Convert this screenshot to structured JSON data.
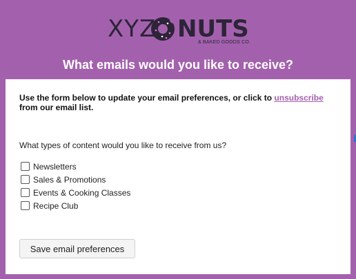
{
  "logo": {
    "part1": "XYZ",
    "part2": "NUTS",
    "tagline": "& BAKED GOODS CO."
  },
  "heading": "What emails would you like to receive?",
  "intro": {
    "before": "Use the form below to update your email preferences, or click to ",
    "link": "unsubscribe",
    "after": " from our email list."
  },
  "question": "What types of content would you like to receive from us?",
  "options": [
    {
      "label": "Newsletters",
      "checked": false
    },
    {
      "label": "Sales & Promotions",
      "checked": false
    },
    {
      "label": "Events & Cooking Classes",
      "checked": false
    },
    {
      "label": "Recipe Club",
      "checked": false
    }
  ],
  "save_button": "Save email preferences",
  "colors": {
    "background": "#a361ad",
    "link": "#a361ad",
    "logo": "#2d2438"
  }
}
